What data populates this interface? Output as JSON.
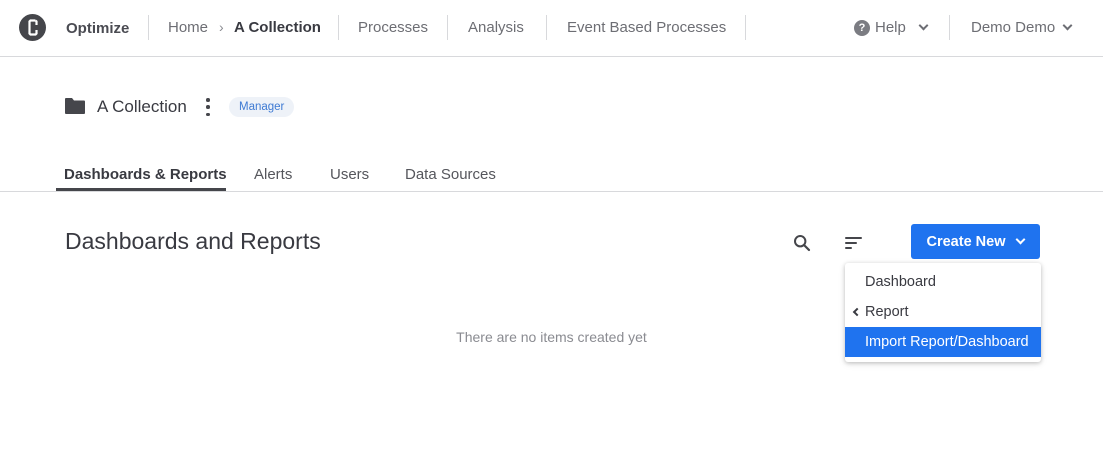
{
  "header": {
    "brand": "Optimize",
    "breadcrumb": {
      "home": "Home",
      "separator": "›",
      "current": "A Collection"
    },
    "nav": [
      "Processes",
      "Analysis",
      "Event Based Processes"
    ],
    "help": "Help",
    "user": "Demo Demo"
  },
  "collection": {
    "name": "A Collection",
    "role": "Manager"
  },
  "tabs": [
    {
      "label": "Dashboards & Reports",
      "active": true
    },
    {
      "label": "Alerts",
      "active": false
    },
    {
      "label": "Users",
      "active": false
    },
    {
      "label": "Data Sources",
      "active": false
    }
  ],
  "content": {
    "title": "Dashboards and Reports",
    "create_button": "Create New",
    "empty_message": "There are no items created yet"
  },
  "dropdown": {
    "items": [
      {
        "label": "Dashboard",
        "submenu": false,
        "highlighted": false
      },
      {
        "label": "Report",
        "submenu": true,
        "highlighted": false
      },
      {
        "label": "Import Report/Dashboard",
        "submenu": false,
        "highlighted": true
      }
    ]
  },
  "colors": {
    "accent": "#1f73ef",
    "badge_bg": "#eef2f8",
    "badge_text": "#3e7ad3"
  },
  "icons": {
    "logo": "camunda-logo-icon",
    "folder": "folder-icon",
    "kebab": "kebab-menu-icon",
    "search": "search-icon",
    "sort": "sort-icon",
    "help": "help-icon"
  }
}
